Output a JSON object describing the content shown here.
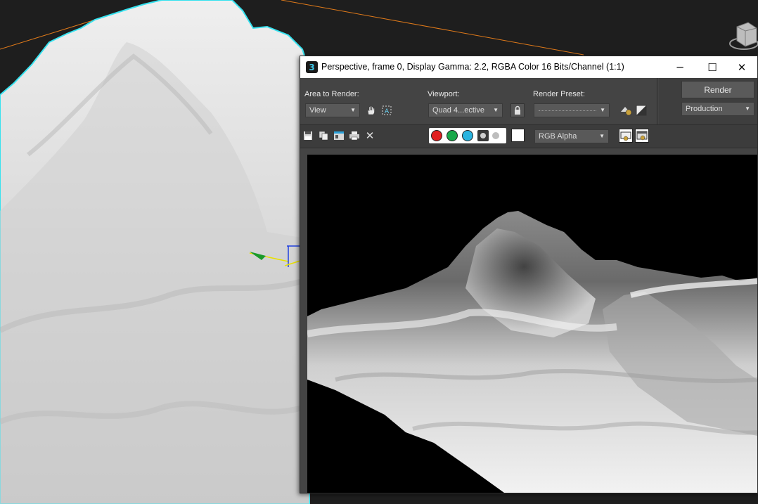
{
  "window": {
    "title": "Perspective, frame 0, Display Gamma: 2.2, RGBA Color 16 Bits/Channel (1:1)",
    "app_icon_text": "3",
    "minimize_glyph": "─",
    "maximize_glyph": "☐",
    "close_glyph": "✕"
  },
  "controls": {
    "area_to_render_label": "Area to Render:",
    "area_to_render_value": "View",
    "viewport_label": "Viewport:",
    "viewport_value": "Quad 4...ective",
    "render_preset_label": "Render Preset:",
    "render_preset_value": "",
    "render_button_label": "Render",
    "production_value": "Production",
    "dropdown_arrow": "▼"
  },
  "toolbar": {
    "channel_dropdown_value": "RGB Alpha",
    "close_glyph": "✕"
  },
  "colors": {
    "viewport_bg": "#1e1e1e",
    "selection_outline": "#2ee6f2",
    "orange_line": "#e07a1a",
    "red_channel": "#e02020",
    "green_channel": "#1aa84a",
    "blue_channel": "#2ab4e0"
  },
  "icons": [
    "app-3dsmax-icon",
    "pan-hand-icon",
    "region-select-icon",
    "lock-icon",
    "render-setup-icon",
    "environment-icon",
    "save-icon",
    "copy-icon",
    "clone-frame-icon",
    "print-icon",
    "clear-icon",
    "display-alpha-icon",
    "monochrome-icon",
    "frame-window-icon",
    "render-frame-icon",
    "viewcube-icon"
  ]
}
